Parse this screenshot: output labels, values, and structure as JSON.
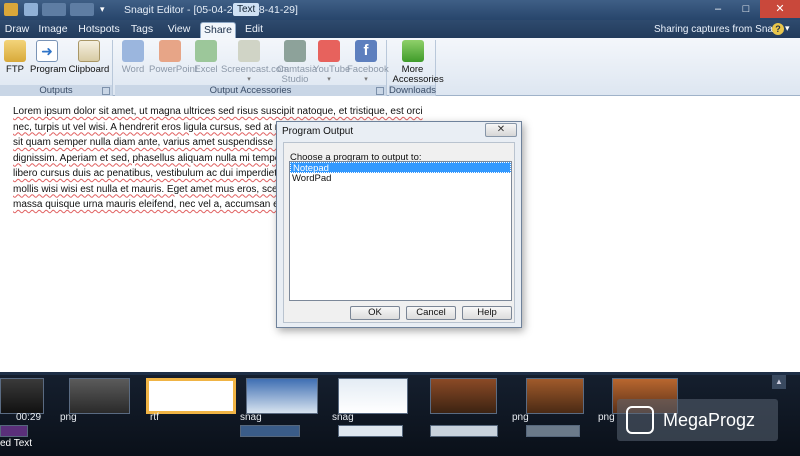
{
  "window": {
    "title": "Snagit Editor - [05-04-2012 18-41-29]",
    "title_badge": "Text",
    "controls": [
      "minimize",
      "maximize",
      "close"
    ]
  },
  "tabs": [
    {
      "label": "Draw"
    },
    {
      "label": "Image"
    },
    {
      "label": "Hotspots"
    },
    {
      "label": "Tags"
    },
    {
      "label": "View"
    },
    {
      "label": "Share",
      "active": true
    },
    {
      "label": "Edit"
    }
  ],
  "header_status": "Sharing captures from Snagit",
  "ribbon": {
    "outputs": {
      "label": "Outputs",
      "buttons": [
        {
          "label": "FTP",
          "icon": "ftp-folder-icon"
        },
        {
          "label": "Program",
          "icon": "program-arrow-icon"
        },
        {
          "label": "Clipboard",
          "icon": "clipboard-icon"
        }
      ]
    },
    "accessories": {
      "label": "Output Accessories",
      "buttons": [
        {
          "label": "Word",
          "icon": "word-icon"
        },
        {
          "label": "PowerPoint",
          "icon": "powerpoint-icon"
        },
        {
          "label": "Excel",
          "icon": "excel-icon"
        },
        {
          "label": "Screencast.com",
          "icon": "screencast-icon"
        },
        {
          "label": "Camtasia Studio",
          "icon": "camtasia-icon"
        },
        {
          "label": "YouTube",
          "icon": "youtube-icon"
        },
        {
          "label": "Facebook",
          "icon": "facebook-icon"
        }
      ]
    },
    "downloads": {
      "label": "Downloads",
      "buttons": [
        {
          "label": "More Accessories",
          "icon": "download-arrow-icon"
        }
      ]
    }
  },
  "document": {
    "lines": [
      "Lorem ipsum dolor sit amet, ut magna ultrices sed risus suscipit natoque, et tristique, est orci",
      "nec, turpis ut vel wisi. A hendrerit eros ligula cursus, sed at nisl",
      "sit quam semper nulla diam ante, varius amet suspendisse en",
      "dignissim. Aperiam et sed, phasellus aliquam nulla mi tempor",
      "libero cursus duis ac penatibus, vestibulum ac dui imperdiet to",
      "mollis wisi wisi est nulla et mauris. Eget amet mus eros, sceler",
      "massa quisque urna mauris eleifend, nec vel a, accumsan est q"
    ]
  },
  "dialog": {
    "title": "Program Output",
    "prompt": "Choose a program to output to:",
    "items": [
      "Notepad",
      "WordPad"
    ],
    "selected": "Notepad",
    "buttons": {
      "ok": "OK",
      "cancel": "Cancel",
      "help": "Help"
    }
  },
  "tray": {
    "thumbnails": [
      {
        "label": "00:29"
      },
      {
        "label": "png"
      },
      {
        "label": "rtf"
      },
      {
        "label": "snag"
      },
      {
        "label": "snag"
      },
      {
        "label": "png"
      },
      {
        "label": "png"
      }
    ],
    "bottom_label": "ed Text"
  },
  "watermark": "MegaProgz"
}
